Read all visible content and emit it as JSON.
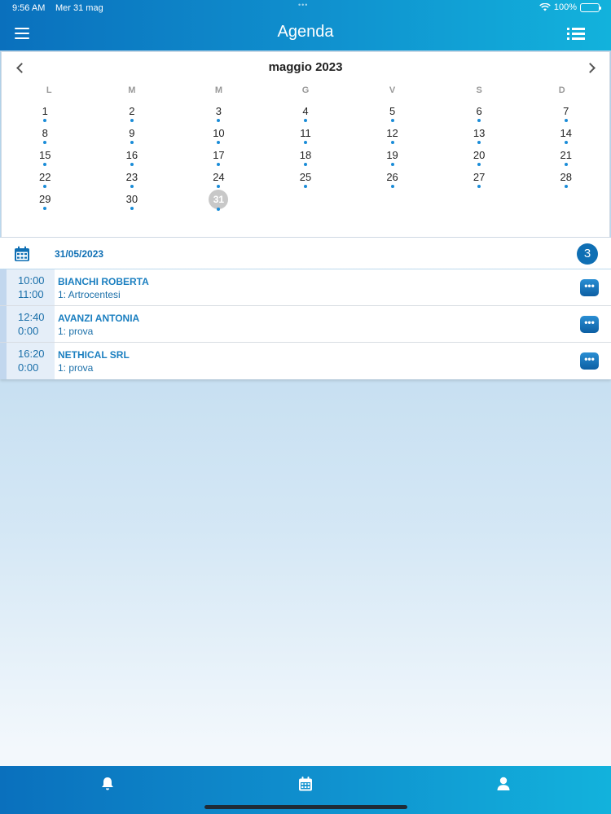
{
  "status_bar": {
    "time": "9:56 AM",
    "date": "Mer 31 mag",
    "dots": "•••",
    "battery": "100%"
  },
  "nav": {
    "title": "Agenda",
    "menu_icon": "hamburger-icon",
    "list_icon": "list-icon"
  },
  "calendar": {
    "month_label": "maggio 2023",
    "weekdays": [
      "L",
      "M",
      "M",
      "G",
      "V",
      "S",
      "D"
    ],
    "start_offset": 0,
    "days": [
      {
        "n": "1",
        "dot": true
      },
      {
        "n": "2",
        "dot": true
      },
      {
        "n": "3",
        "dot": true
      },
      {
        "n": "4",
        "dot": true
      },
      {
        "n": "5",
        "dot": true
      },
      {
        "n": "6",
        "dot": true
      },
      {
        "n": "7",
        "dot": true
      },
      {
        "n": "8",
        "dot": true
      },
      {
        "n": "9",
        "dot": true
      },
      {
        "n": "10",
        "dot": true
      },
      {
        "n": "11",
        "dot": true
      },
      {
        "n": "12",
        "dot": true
      },
      {
        "n": "13",
        "dot": true
      },
      {
        "n": "14",
        "dot": true
      },
      {
        "n": "15",
        "dot": true
      },
      {
        "n": "16",
        "dot": true
      },
      {
        "n": "17",
        "dot": true
      },
      {
        "n": "18",
        "dot": true
      },
      {
        "n": "19",
        "dot": true
      },
      {
        "n": "20",
        "dot": true
      },
      {
        "n": "21",
        "dot": true
      },
      {
        "n": "22",
        "dot": true
      },
      {
        "n": "23",
        "dot": true
      },
      {
        "n": "24",
        "dot": true
      },
      {
        "n": "25",
        "dot": true
      },
      {
        "n": "26",
        "dot": true
      },
      {
        "n": "27",
        "dot": true
      },
      {
        "n": "28",
        "dot": true
      },
      {
        "n": "29",
        "dot": true
      },
      {
        "n": "30",
        "dot": true
      },
      {
        "n": "31",
        "dot": true,
        "selected": true
      }
    ]
  },
  "day_header": {
    "date": "31/05/2023",
    "count": "3",
    "icon": "calendar-icon"
  },
  "appointments": [
    {
      "start": "10:00",
      "end": "11:00",
      "name": "BIANCHI ROBERTA",
      "desc": "1: Artrocentesi",
      "more": "•••"
    },
    {
      "start": "12:40",
      "end": "0:00",
      "name": "AVANZI ANTONIA",
      "desc": "1: prova",
      "more": "•••"
    },
    {
      "start": "16:20",
      "end": "0:00",
      "name": "NETHICAL SRL",
      "desc": "1: prova",
      "more": "•••"
    }
  ],
  "tab_bar": {
    "items": [
      "bell-icon",
      "calendar-icon",
      "user-icon"
    ]
  },
  "colors": {
    "accent": "#0f6fb4",
    "bar_start": "#0a70bd",
    "bar_end": "#12b2dc",
    "event_dot": "#1a8cd8",
    "selected_day": "#c8c8c8"
  }
}
